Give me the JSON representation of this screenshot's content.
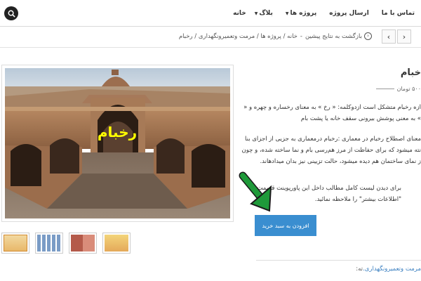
{
  "nav": {
    "search_icon": "search-icon",
    "items": [
      {
        "label": "خانه"
      },
      {
        "label": "بلاگ"
      },
      {
        "label": "پروژه ها"
      },
      {
        "label": "ارسال پروژه"
      },
      {
        "label": "تماس با ما"
      }
    ]
  },
  "breadcrumb": {
    "back_label": "بازگشت به نتایج پیشین",
    "separator": "-",
    "path": "خانه / پروژه ها / مرمت وتعمیرونگهداری / رخبام"
  },
  "product": {
    "title": "خبام",
    "price": "۵۰۰ تومان",
    "paragraph1_line1": "ازه رخبام متشکل است ازدوکلمه: « رخ » به معنای رخساره و چهره و «",
    "paragraph1_line2": "» به معنی پوشش بیرونی سقف خانه یا پشت بام",
    "paragraph2_line1": "معنای اصطلاح رخبام در معماری :رخبام درمعماری به جزیی از اجزای بنا",
    "paragraph2_line2": "نته میشود که برای حفاظت از مرز هم‌رسی بام و نما ساخته شده، و چون",
    "paragraph2_line3": "ز نمای ساختمان هم دیده میشود، حالت تزیینی نیز بدان میدادهاند.",
    "paragraph3_line1": "برای دیدن لیست کامل مطالب داخل این پاورپوینت قسمت",
    "paragraph3_line2": "\"اطلاعات بیشتر\" را ملاحظه نمائید.",
    "add_to_cart": "افزودن به سبد خرید",
    "image_overlay_text": "رخبام",
    "category_label": "ته:",
    "category_link": "مرمت وتعمیرونگهداری."
  },
  "colors": {
    "button_blue": "#3a8ed0",
    "arrow_green": "#1f9a3a",
    "overlay_yellow": "#ffff00"
  }
}
